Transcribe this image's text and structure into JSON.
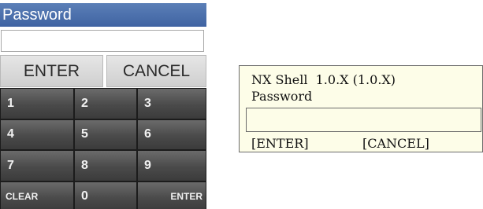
{
  "touch_panel": {
    "title": "Password",
    "password_value": "",
    "enter_label": "ENTER",
    "cancel_label": "CANCEL",
    "keypad": [
      {
        "label": "1",
        "name": "key-1"
      },
      {
        "label": "2",
        "name": "key-2"
      },
      {
        "label": "3",
        "name": "key-3"
      },
      {
        "label": "4",
        "name": "key-4"
      },
      {
        "label": "5",
        "name": "key-5"
      },
      {
        "label": "6",
        "name": "key-6"
      },
      {
        "label": "7",
        "name": "key-7"
      },
      {
        "label": "8",
        "name": "key-8"
      },
      {
        "label": "9",
        "name": "key-9"
      },
      {
        "label": "CLEAR",
        "name": "key-clear"
      },
      {
        "label": "0",
        "name": "key-0"
      },
      {
        "label": "ENTER",
        "name": "key-enter"
      }
    ],
    "colors": {
      "header": "#4a6fad",
      "keypad_bg": "#2f2f2f",
      "key_text": "#f1f1f1"
    }
  },
  "shell_dialog": {
    "title": "NX Shell  1.0.X (1.0.X)",
    "prompt": "Password",
    "password_value": "",
    "enter_label": "[ENTER]",
    "cancel_label": "[CANCEL]",
    "colors": {
      "background": "#fdfde8",
      "border": "#6b6b6b"
    }
  }
}
